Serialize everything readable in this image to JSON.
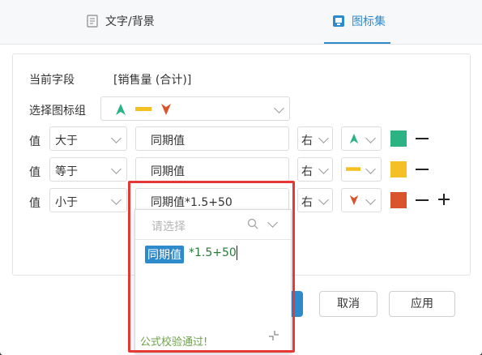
{
  "tabs": [
    {
      "label": "文字/背景",
      "icon": "document-icon",
      "active": false
    },
    {
      "label": "图标集",
      "icon": "icon-set-icon",
      "active": true
    }
  ],
  "current_field": {
    "label": "当前字段",
    "value": "[销售量 (合计)]"
  },
  "icon_group": {
    "label": "选择图标组",
    "icons": [
      "arrow-up-green-icon",
      "bar-yellow-icon",
      "arrow-down-red-icon"
    ]
  },
  "rules": [
    {
      "label": "值",
      "operator": "大于",
      "value": "同期值",
      "align": "右",
      "icon": "arrow-up-green-icon",
      "color": "#2bb383",
      "actions": [
        "minus"
      ]
    },
    {
      "label": "值",
      "operator": "等于",
      "value": "同期值",
      "align": "右",
      "icon": "bar-yellow-icon",
      "color": "#f5c024",
      "actions": [
        "minus"
      ]
    },
    {
      "label": "值",
      "operator": "小于",
      "value": "同期值*1.5+50",
      "align": "右",
      "icon": "arrow-down-red-icon",
      "color": "#d9532c",
      "actions": [
        "minus",
        "plus"
      ]
    }
  ],
  "formula_popup": {
    "placeholder": "请选择",
    "token": "同期值",
    "rest": "*1.5+50",
    "status": "公式校验通过!"
  },
  "buttons": {
    "cancel": "取消",
    "apply": "应用"
  },
  "colors": {
    "accent": "#2d8acb",
    "highlight": "#e53935",
    "success": "#6da24a"
  }
}
